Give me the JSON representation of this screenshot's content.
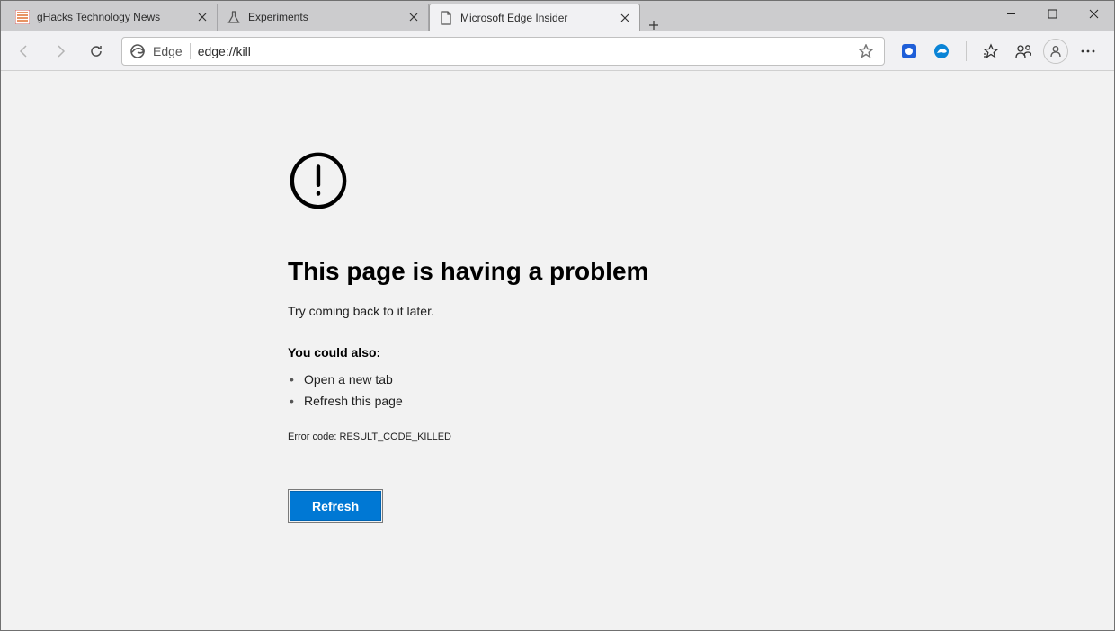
{
  "tabs": [
    {
      "title": "gHacks Technology News",
      "favicon": "ghacks"
    },
    {
      "title": "Experiments",
      "favicon": "flask"
    },
    {
      "title": "Microsoft Edge Insider",
      "favicon": "page-error",
      "active": true
    }
  ],
  "addressbar": {
    "origin_label": "Edge",
    "url": "edge://kill"
  },
  "page": {
    "heading": "This page is having a problem",
    "subtitle": "Try coming back to it later.",
    "could_also": "You could also:",
    "suggestions": [
      "Open a new tab",
      "Refresh this page"
    ],
    "error_code_label": "Error code:",
    "error_code": "RESULT_CODE_KILLED",
    "refresh_button": "Refresh"
  }
}
